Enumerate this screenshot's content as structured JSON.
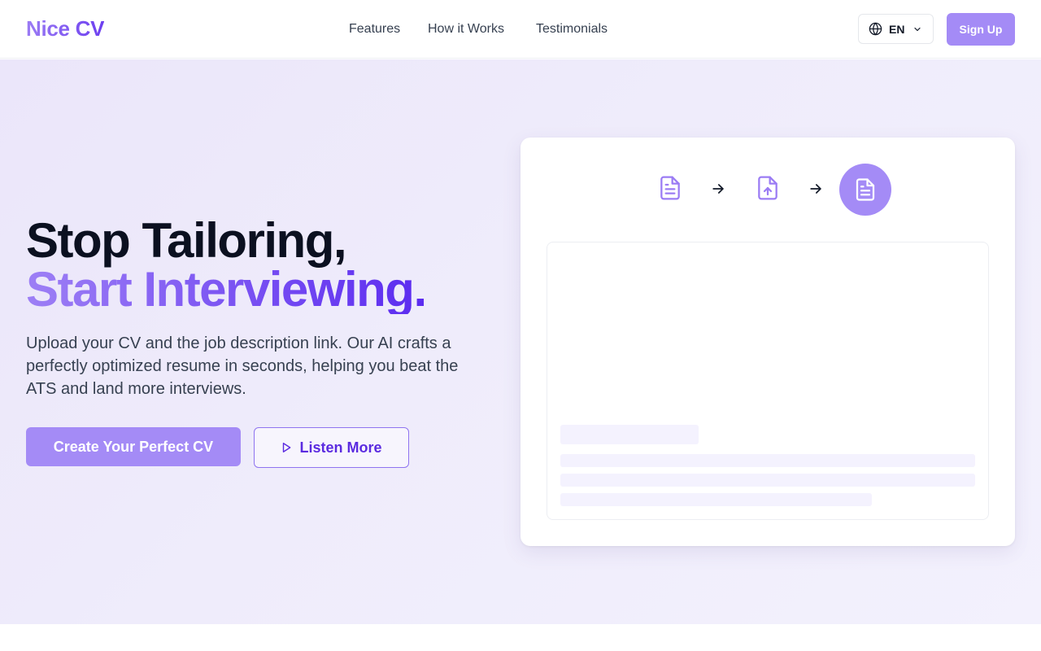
{
  "brand": {
    "name": "Nice CV"
  },
  "nav": {
    "links": [
      "Features",
      "How it Works",
      "Testimonials"
    ]
  },
  "language": {
    "code": "EN",
    "icon": "globe-icon",
    "dropdown_icon": "chevron-down-icon"
  },
  "auth": {
    "signup_label": "Sign Up"
  },
  "hero": {
    "headline_line1": "Stop Tailoring,",
    "headline_line2": "Start Interviewing.",
    "subtext": "Upload your CV and the job description link. Our AI crafts a perfectly optimized resume in seconds, helping you beat the ATS and land more interviews.",
    "cta_primary": "Create Your Perfect CV",
    "cta_secondary": "Listen More",
    "cta_secondary_icon": "play-icon"
  },
  "workflow": {
    "steps": [
      "document-icon",
      "arrow-right-icon",
      "document-upload-icon",
      "arrow-right-icon",
      "document-icon"
    ]
  },
  "colors": {
    "accent": "#a48bf6",
    "accent_dark": "#5b2bf0",
    "hero_bg": "#ece8fa",
    "text_primary": "#0b1020",
    "text_secondary": "#374151"
  }
}
